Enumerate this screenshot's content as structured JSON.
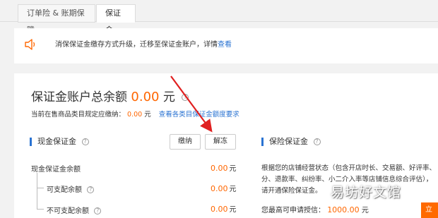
{
  "tabs": [
    {
      "label": "订单险 & 账期保障"
    },
    {
      "label": "保证金"
    }
  ],
  "notice": {
    "text": "消保保证金缴存方式升级，迁移至保证金账户，详情",
    "link": "查看"
  },
  "account": {
    "title": "保证金账户总余额",
    "amount": "0.00",
    "unit": "元",
    "help": "?"
  },
  "category_requirement": {
    "label": "当前在售商品类目规定应缴纳：",
    "amount": "0.00",
    "unit": "元",
    "link": "查看各类目保证金额度要求"
  },
  "cash_deposit": {
    "title": "现金保证金",
    "help": "?",
    "pay_button": "缴纳",
    "unfreeze_button": "解冻",
    "rows": [
      {
        "label": "现金保证金余额",
        "amount": "0.00",
        "unit": "元"
      },
      {
        "label": "可支配余额",
        "amount": "0.00",
        "unit": "元"
      },
      {
        "label": "不可支配余额",
        "amount": "0.00",
        "unit": "元"
      }
    ]
  },
  "insurance_deposit": {
    "title": "保险保证金",
    "help": "?",
    "desc_line1": "根据您的店铺经营状态（包含开店时长、交易额、好评率、",
    "desc_line2": "分、退款率、纠纷率、小二介入率等店铺信息综合评估），",
    "desc_line3": "请开通保险保证金。",
    "credit_label": "您最高可申请授信：",
    "credit_amount": "1000.00",
    "credit_unit": "元",
    "apply_button": "立即"
  },
  "watermark": "易坊好文馆",
  "colors": {
    "accent_blue": "#2a73d2",
    "amount_orange": "#ff6600",
    "arrow_red": "#e02020"
  }
}
